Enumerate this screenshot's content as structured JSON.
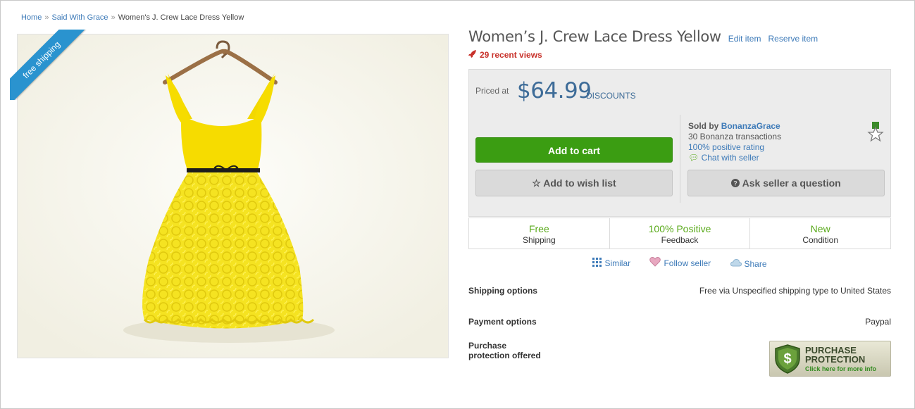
{
  "breadcrumb": {
    "items": [
      "Home",
      "Said With Grace"
    ],
    "current": "Women's J. Crew Lace Dress Yellow",
    "separator": "»"
  },
  "ribbon": {
    "label": "free shipping"
  },
  "product": {
    "title": "Women’s J. Crew Lace Dress Yellow",
    "edit_link": "Edit item",
    "reserve_link": "Reserve item",
    "views": "29 recent views"
  },
  "pricing": {
    "priced_label": "Priced at",
    "price": "$64.99",
    "discounts": "DISCOUNTS"
  },
  "actions": {
    "add_to_cart": "Add to cart",
    "add_to_wishlist": "Add to wish list",
    "ask_seller": "Ask seller a question"
  },
  "seller": {
    "sold_by": "Sold by",
    "name": "BonanzaGrace",
    "transactions": "30 Bonanza transactions",
    "rating": "100% positive rating",
    "chat": "Chat with seller"
  },
  "stats": [
    {
      "value": "Free",
      "label": "Shipping"
    },
    {
      "value": "100% Positive",
      "label": "Feedback"
    },
    {
      "value": "New",
      "label": "Condition"
    }
  ],
  "social": {
    "similar": "Similar",
    "follow": "Follow seller",
    "share": "Share"
  },
  "options": {
    "shipping_label": "Shipping options",
    "shipping_value": "Free via Unspecified shipping type to United States",
    "payment_label": "Payment options",
    "payment_value": "Paypal",
    "protection_label_1": "Purchase",
    "protection_label_2": "protection offered"
  },
  "protection_badge": {
    "line1": "PURCHASE",
    "line2": "PROTECTION",
    "line3": "Click here for more info"
  },
  "colors": {
    "accent_blue": "#3d7ab8",
    "price_blue": "#3e6c98",
    "cart_green": "#3b9d12",
    "stat_green": "#5aaa1b",
    "views_red": "#c8322b",
    "ribbon_blue": "#2a93cf",
    "dress_yellow": "#f5e321"
  },
  "icons": {
    "views": "rocket-icon",
    "wishlist": "star-outline-icon",
    "ask": "question-circle-icon",
    "chat": "speech-bubble-icon",
    "similar": "grid-icon",
    "follow": "heart-icon",
    "share": "cloud-icon",
    "seller_badge": "star-ribbon-icon"
  }
}
